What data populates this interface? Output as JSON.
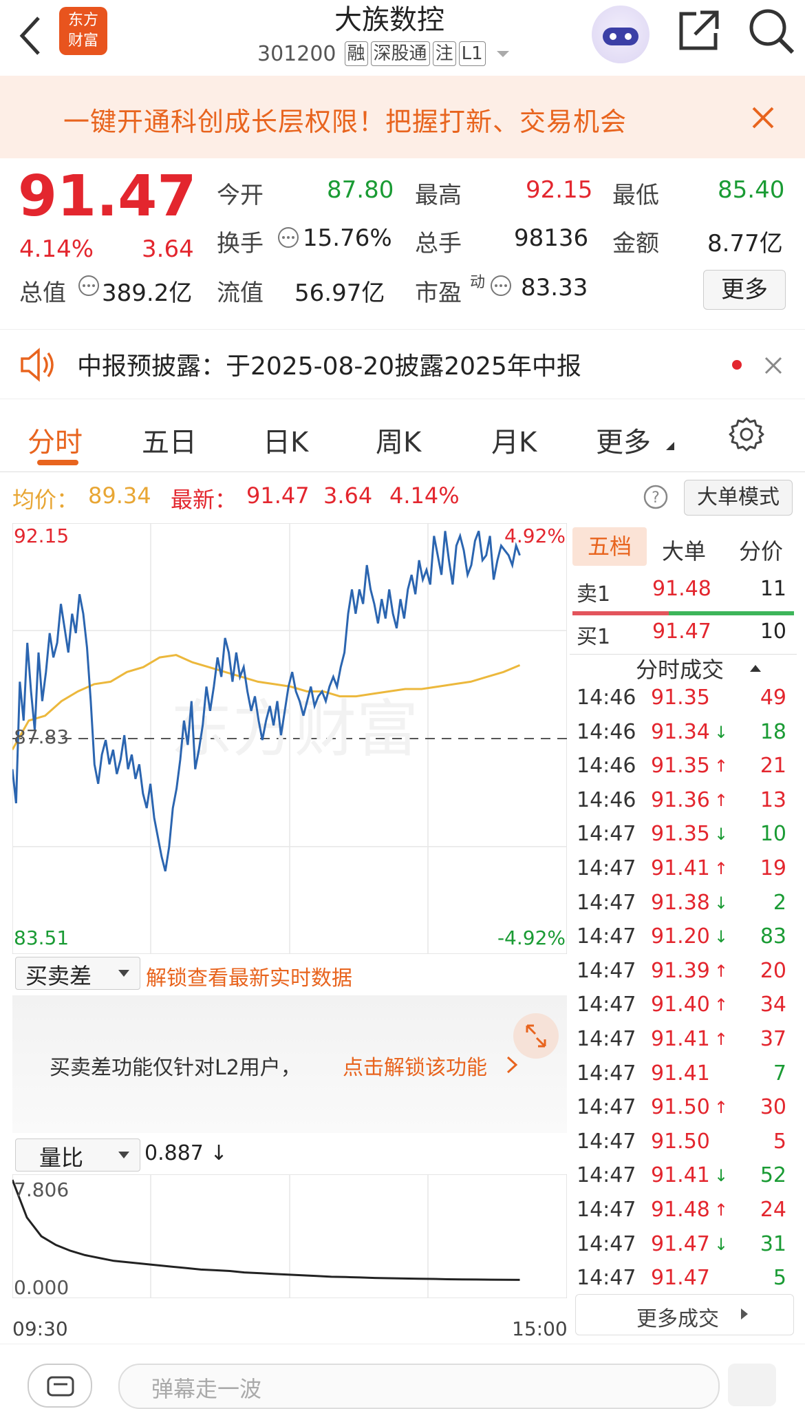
{
  "header": {
    "logo_text": "东方财富",
    "stock_name": "大族数控",
    "stock_code": "301200",
    "tags": [
      "融",
      "深股通",
      "注",
      "L1"
    ]
  },
  "banner": {
    "text": "一键开通科创成长层权限！把握打新、交易机会"
  },
  "quote": {
    "price": "91.47",
    "change_pct": "4.14%",
    "change": "3.64",
    "open_label": "今开",
    "open": "87.80",
    "high_label": "最高",
    "high": "92.15",
    "low_label": "最低",
    "low": "85.40",
    "turnover_label": "换手",
    "turnover": "15.76%",
    "volume_label": "总手",
    "volume": "98136",
    "amount_label": "金额",
    "amount": "8.77亿",
    "mktcap_label": "总值",
    "mktcap": "389.2亿",
    "float_label": "流值",
    "float": "56.97亿",
    "pe_label": "市盈",
    "pe_sup": "动",
    "pe": "83.33",
    "more_button": "更多"
  },
  "notice": {
    "text": "中报预披露：于2025-08-20披露2025年中报"
  },
  "tabs": [
    "分时",
    "五日",
    "日K",
    "周K",
    "月K",
    "更多"
  ],
  "pricebar": {
    "avg_label": "均价：",
    "avg": "89.34",
    "latest_label": "最新：",
    "latest": "91.47",
    "change": "3.64",
    "pct": "4.14%",
    "mode_button": "大单模式"
  },
  "chart_data": {
    "type": "line",
    "y_max_label": "92.15",
    "y_min_label": "83.51",
    "y_prev_close_label": "87.83",
    "pct_max_label": "4.92%",
    "pct_min_label": "-4.92%",
    "ylim": [
      83.51,
      92.15
    ],
    "prev_close": 87.83,
    "series": [
      {
        "values": [
          87.2,
          86.5,
          89.0,
          88.2,
          89.8,
          88.8,
          88.0,
          89.6,
          88.6,
          89.2,
          90.0,
          89.5,
          89.8,
          90.6,
          90.1,
          89.6,
          90.4,
          90.0,
          90.8,
          90.4,
          89.7,
          88.6,
          87.3,
          86.9,
          87.5,
          87.8,
          87.3,
          87.6,
          87.1,
          87.4,
          87.9,
          87.2,
          87.5,
          87.0,
          87.3,
          86.7,
          86.4,
          86.9,
          86.2,
          85.8,
          85.4,
          85.1,
          85.6,
          86.4,
          86.8,
          87.4,
          88.2,
          87.7,
          88.6,
          87.2,
          87.6,
          88.1,
          88.9,
          88.4,
          88.9,
          89.5,
          89.1,
          89.9,
          89.6,
          89.0,
          89.6,
          89.1,
          89.3,
          88.8,
          88.4,
          88.7,
          88.2,
          87.8,
          88.2,
          88.5,
          88.1,
          88.6,
          87.9,
          88.4,
          88.9,
          89.2,
          88.8,
          88.6,
          88.3,
          88.6,
          88.9,
          88.5,
          88.7,
          88.8,
          88.6,
          88.9,
          89.1,
          88.9,
          89.3,
          89.6,
          90.4,
          90.9,
          90.4,
          90.9,
          90.6,
          91.4,
          90.9,
          90.6,
          90.2,
          90.7,
          90.3,
          90.9,
          90.4,
          90.1,
          90.7,
          90.3,
          90.9,
          91.2,
          90.8,
          91.5,
          91.1,
          91.3,
          91.0,
          92.0,
          91.6,
          91.2,
          92.1,
          91.5,
          91.0,
          91.8,
          92.0,
          91.7,
          91.2,
          91.4,
          91.9,
          92.1,
          91.5,
          91.6,
          92.0,
          91.1,
          91.5,
          91.8,
          91.7,
          91.6,
          91.4,
          91.8,
          91.6
        ]
      },
      {
        "values": [
          87.6,
          88.2,
          88.3,
          88.6,
          88.8,
          88.95,
          89.0,
          89.2,
          89.3,
          89.5,
          89.55,
          89.4,
          89.3,
          89.2,
          89.1,
          89.0,
          88.95,
          88.9,
          88.8,
          88.8,
          88.7,
          88.7,
          88.75,
          88.8,
          88.85,
          88.85,
          88.9,
          88.95,
          89.0,
          89.1,
          89.2,
          89.34
        ]
      }
    ],
    "x_labels": [
      "09:30",
      "15:00"
    ]
  },
  "five_levels": {
    "tabs": [
      "五档",
      "大单",
      "分价"
    ],
    "sell": {
      "label": "卖1",
      "price": "91.48",
      "qty": "11"
    },
    "buy": {
      "label": "买1",
      "price": "91.47",
      "qty": "10"
    }
  },
  "trades": {
    "title": "分时成交",
    "rows": [
      {
        "t": "14:46",
        "p": "91.35",
        "a": "",
        "v": "49",
        "c": "red"
      },
      {
        "t": "14:46",
        "p": "91.34",
        "a": "↓",
        "v": "18",
        "c": "green"
      },
      {
        "t": "14:46",
        "p": "91.35",
        "a": "↑",
        "v": "21",
        "c": "red"
      },
      {
        "t": "14:46",
        "p": "91.36",
        "a": "↑",
        "v": "13",
        "c": "red"
      },
      {
        "t": "14:47",
        "p": "91.35",
        "a": "↓",
        "v": "10",
        "c": "green"
      },
      {
        "t": "14:47",
        "p": "91.41",
        "a": "↑",
        "v": "19",
        "c": "red"
      },
      {
        "t": "14:47",
        "p": "91.38",
        "a": "↓",
        "v": "2",
        "c": "green"
      },
      {
        "t": "14:47",
        "p": "91.20",
        "a": "↓",
        "v": "83",
        "c": "green"
      },
      {
        "t": "14:47",
        "p": "91.39",
        "a": "↑",
        "v": "20",
        "c": "red"
      },
      {
        "t": "14:47",
        "p": "91.40",
        "a": "↑",
        "v": "34",
        "c": "red"
      },
      {
        "t": "14:47",
        "p": "91.41",
        "a": "↑",
        "v": "37",
        "c": "red"
      },
      {
        "t": "14:47",
        "p": "91.41",
        "a": "",
        "v": "7",
        "c": "green"
      },
      {
        "t": "14:47",
        "p": "91.50",
        "a": "↑",
        "v": "30",
        "c": "red"
      },
      {
        "t": "14:47",
        "p": "91.50",
        "a": "",
        "v": "5",
        "c": "red"
      },
      {
        "t": "14:47",
        "p": "91.41",
        "a": "↓",
        "v": "52",
        "c": "green"
      },
      {
        "t": "14:47",
        "p": "91.48",
        "a": "↑",
        "v": "24",
        "c": "red"
      },
      {
        "t": "14:47",
        "p": "91.47",
        "a": "↓",
        "v": "31",
        "c": "green"
      },
      {
        "t": "14:47",
        "p": "91.47",
        "a": "",
        "v": "5",
        "c": "green"
      }
    ],
    "more_button": "更多成交"
  },
  "buysell": {
    "dropdown": "买卖差",
    "unlock_link": "解锁查看最新实时数据",
    "locked_msg": "买卖差功能仅针对L2用户，",
    "locked_link": "点击解锁该功能"
  },
  "volume_ratio": {
    "dropdown": "量比",
    "value": "0.887 ↓",
    "y_max_label": "7.806",
    "y_min_label": "0.000",
    "series": [
      7.8,
      5.2,
      3.9,
      3.3,
      2.9,
      2.6,
      2.4,
      2.2,
      2.1,
      2.0,
      1.9,
      1.8,
      1.7,
      1.6,
      1.55,
      1.5,
      1.4,
      1.35,
      1.3,
      1.25,
      1.2,
      1.15,
      1.1,
      1.08,
      1.05,
      1.02,
      1.0,
      0.98,
      0.96,
      0.95,
      0.93,
      0.92,
      0.91,
      0.9,
      0.89,
      0.887
    ]
  },
  "bottom": {
    "input_placeholder": "弹幕走一波"
  }
}
